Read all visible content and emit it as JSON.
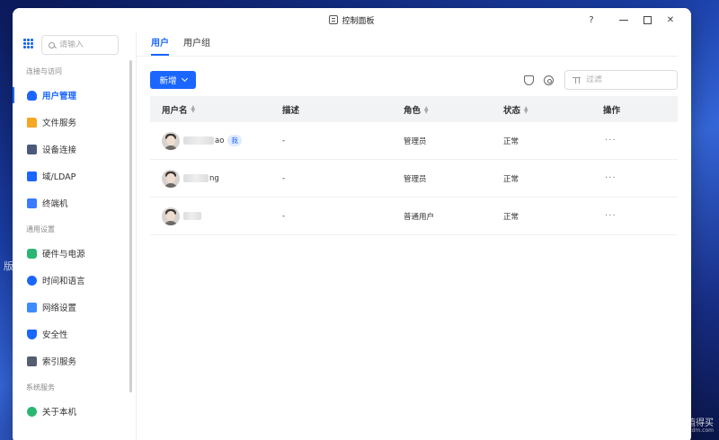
{
  "desktop": {
    "left_text": "版",
    "watermark": "什么值得买",
    "watermark_sub": "www.smzdm.com"
  },
  "window": {
    "title": "控制面板",
    "help": "?"
  },
  "sidebar": {
    "search_placeholder": "请输入",
    "groups": [
      {
        "label": "连接与访问"
      },
      {
        "label": "通用设置"
      },
      {
        "label": "系统服务"
      }
    ],
    "items": [
      {
        "label": "用户管理",
        "icon": "user-icon",
        "active": true
      },
      {
        "label": "文件服务",
        "icon": "folder-icon"
      },
      {
        "label": "设备连接",
        "icon": "device-icon"
      },
      {
        "label": "域/LDAP",
        "icon": "ldap-icon"
      },
      {
        "label": "终端机",
        "icon": "terminal-icon"
      },
      {
        "label": "硬件与电源",
        "icon": "hardware-icon"
      },
      {
        "label": "时间和语言",
        "icon": "clock-icon"
      },
      {
        "label": "网络设置",
        "icon": "network-icon"
      },
      {
        "label": "安全性",
        "icon": "shield-icon"
      },
      {
        "label": "索引服务",
        "icon": "index-icon"
      },
      {
        "label": "关于本机",
        "icon": "info-icon"
      }
    ]
  },
  "main": {
    "tabs": [
      {
        "label": "用户",
        "active": true
      },
      {
        "label": "用户组"
      }
    ],
    "new_button": "新增",
    "filter_placeholder": "过滤",
    "columns": [
      "用户名",
      "描述",
      "角色",
      "状态",
      "操作"
    ],
    "rows": [
      {
        "username_suffix": "ao",
        "badge": "我",
        "description": "-",
        "role": "管理员",
        "status": "正常",
        "action": "···"
      },
      {
        "username_suffix": "ng",
        "badge": "",
        "description": "-",
        "role": "管理员",
        "status": "正常",
        "action": "···"
      },
      {
        "username_suffix": "",
        "badge": "",
        "description": "-",
        "role": "普通用户",
        "status": "正常",
        "action": "···"
      }
    ]
  },
  "colors": {
    "accent": "#1a66ff",
    "header_bg": "#f2f3f5"
  }
}
